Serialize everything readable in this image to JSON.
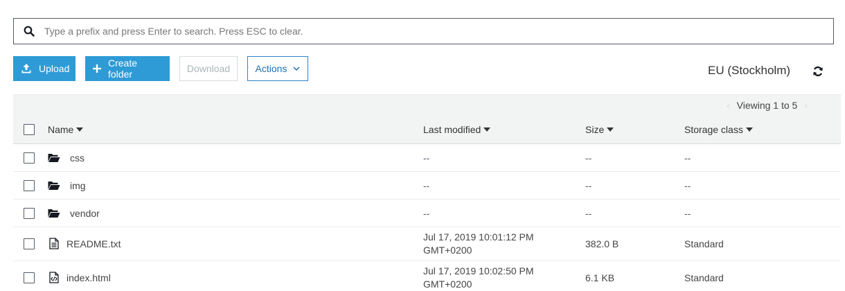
{
  "search": {
    "placeholder": "Type a prefix and press Enter to search. Press ESC to clear."
  },
  "toolbar": {
    "upload_label": "Upload",
    "create_folder_label": "Create folder",
    "download_label": "Download",
    "actions_label": "Actions"
  },
  "region": "EU (Stockholm)",
  "pager": {
    "label": "Viewing 1 to 5"
  },
  "table": {
    "columns": {
      "name": "Name",
      "last_modified": "Last modified",
      "size": "Size",
      "storage_class": "Storage class"
    },
    "rows": [
      {
        "type": "folder",
        "name": "css",
        "last_modified_1": "--",
        "last_modified_2": "",
        "size": "--",
        "storage_class": "--"
      },
      {
        "type": "folder",
        "name": "img",
        "last_modified_1": "--",
        "last_modified_2": "",
        "size": "--",
        "storage_class": "--"
      },
      {
        "type": "folder",
        "name": "vendor",
        "last_modified_1": "--",
        "last_modified_2": "",
        "size": "--",
        "storage_class": "--"
      },
      {
        "type": "text-file",
        "name": "README.txt",
        "last_modified_1": "Jul 17, 2019 10:01:12 PM",
        "last_modified_2": "GMT+0200",
        "size": "382.0 B",
        "storage_class": "Standard"
      },
      {
        "type": "code-file",
        "name": "index.html",
        "last_modified_1": "Jul 17, 2019 10:02:50 PM",
        "last_modified_2": "GMT+0200",
        "size": "6.1 KB",
        "storage_class": "Standard"
      }
    ]
  },
  "colors": {
    "primary": "#2e9bd6",
    "link": "#1f6fb2",
    "header_bg": "#f2f3f3",
    "border": "#545b64"
  }
}
